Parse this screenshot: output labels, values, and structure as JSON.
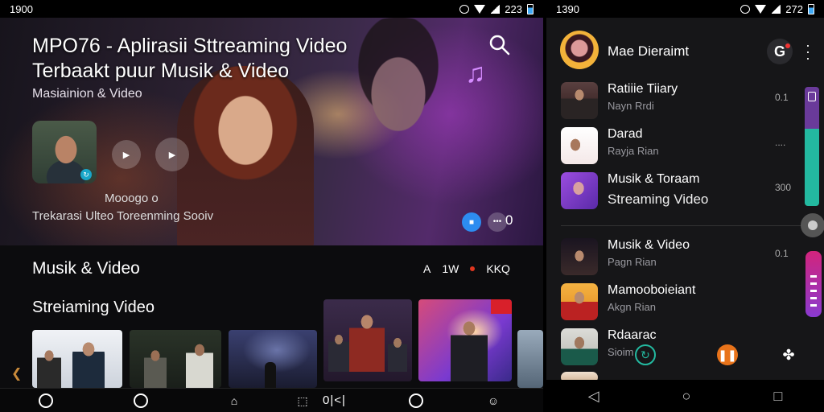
{
  "left_screen": {
    "status": {
      "time": "1900",
      "battery_text": "223"
    },
    "hero": {
      "title": "MPO76 - Aplirasii Sttreaming Video Terbaakt puur Musik & Video",
      "subtitle": "Masiainion & Video",
      "caption_line1": "Mooogo o",
      "caption_line2": "Trekarasi Ulteo Toreenming  Sooiv",
      "count": "0"
    },
    "section": {
      "title": "Musik & Video",
      "tool_a": "A",
      "tool_b": "1W",
      "tool_c": "KKQ",
      "subtitle": "Streiaming Video"
    },
    "bottom_nav": {
      "label": "0|<|"
    }
  },
  "right_screen": {
    "status": {
      "time": "1390",
      "battery_text": "272"
    },
    "header": {
      "name": "Mae Dieraimt",
      "g_letter": "G"
    },
    "items": [
      {
        "title": "Ratiiie Tiiary",
        "subtitle": "Nayn Rrdi",
        "meta": "0.1"
      },
      {
        "title": "Darad",
        "subtitle": "Rayja Rian",
        "meta": "...."
      },
      {
        "title": "Musik & Toraam",
        "subtitle": "Streaming Video",
        "meta": "300"
      },
      {
        "title": "Musik & Video",
        "subtitle": "Pagn Rian",
        "meta": "0.1"
      },
      {
        "title": "Mamooboieiant",
        "subtitle": "Akgn Rian",
        "meta": ""
      },
      {
        "title": "Rdaarac",
        "subtitle": "Sioim",
        "meta": ""
      }
    ]
  },
  "colors": {
    "accent_blue": "#2d8cf0",
    "accent_teal": "#23b9a0",
    "accent_purple": "#8a3ad0",
    "accent_red": "#e0361f",
    "accent_orange": "#e8731a"
  },
  "icons": [
    "search-icon",
    "music-note-icon",
    "play-icon",
    "share-icon",
    "more-icon",
    "home-icon",
    "compass-icon",
    "library-icon",
    "profile-icon",
    "back-icon",
    "circle-home-icon",
    "recents-icon"
  ]
}
